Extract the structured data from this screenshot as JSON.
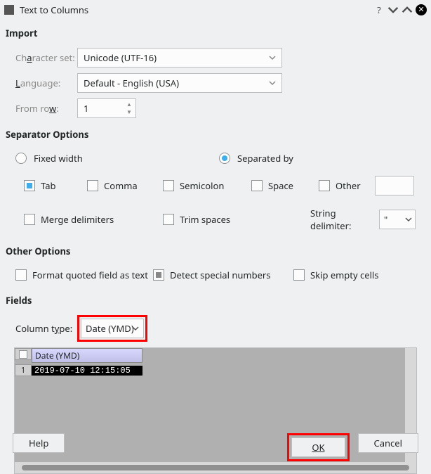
{
  "title": "Text to Columns",
  "sections": {
    "import": "Import",
    "separator": "Separator Options",
    "other": "Other Options",
    "fields": "Fields"
  },
  "import": {
    "charset_label": "Character set:",
    "charset_value": "Unicode (UTF-16)",
    "language_label": "Language:",
    "language_value": "Default - English (USA)",
    "fromrow_label": "From row:",
    "fromrow_value": "1"
  },
  "separator": {
    "fixed_width": "Fixed width",
    "separated_by": "Separated by",
    "tab": "Tab",
    "comma": "Comma",
    "semicolon": "Semicolon",
    "space": "Space",
    "other": "Other",
    "merge_delimiters": "Merge delimiters",
    "trim_spaces": "Trim spaces",
    "string_delimiter_label": "String delimiter:",
    "string_delimiter_value": "\""
  },
  "other_opts": {
    "format_quoted": "Format quoted field as text",
    "detect_numbers": "Detect special numbers",
    "skip_empty": "Skip empty cells"
  },
  "fields": {
    "column_type_label": "Column type:",
    "column_type_value": "Date (YMD)"
  },
  "preview": {
    "col_header": "Date (YMD)",
    "row_num": "1",
    "cell_value": "2019-07-10 12:15:05"
  },
  "buttons": {
    "help": "Help",
    "ok": "OK",
    "cancel": "Cancel"
  }
}
